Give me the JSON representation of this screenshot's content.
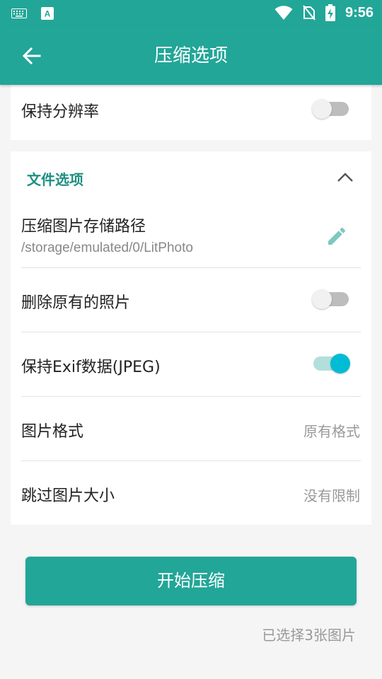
{
  "status_bar": {
    "time": "9:56",
    "left_icons": [
      "keyboard-icon",
      "a-notification-icon"
    ],
    "right_icons": [
      "wifi-icon",
      "no-sim-icon",
      "battery-charging-icon"
    ]
  },
  "toolbar": {
    "title": "压缩选项",
    "back_icon": "arrow-left-icon"
  },
  "card1": {
    "keep_resolution": {
      "label": "保持分辨率",
      "enabled": false
    }
  },
  "file_options": {
    "header": "文件选项",
    "collapse_icon": "chevron-up-icon",
    "storage_path": {
      "label": "压缩图片存储路径",
      "value": "/storage/emulated/0/LitPhoto",
      "icon": "pencil-icon"
    },
    "delete_original": {
      "label": "删除原有的照片",
      "enabled": false
    },
    "keep_exif": {
      "label": "保持Exif数据(JPEG)",
      "enabled": true
    },
    "image_format": {
      "label": "图片格式",
      "value": "原有格式"
    },
    "skip_size": {
      "label": "跳过图片大小",
      "value": "没有限制"
    }
  },
  "actions": {
    "start_label": "开始压缩",
    "selected_text": "已选择3张图片"
  },
  "colors": {
    "primary": "#22a698",
    "accent": "#00bcd4",
    "section_header": "#1e8f82",
    "secondary_text": "#999999"
  }
}
